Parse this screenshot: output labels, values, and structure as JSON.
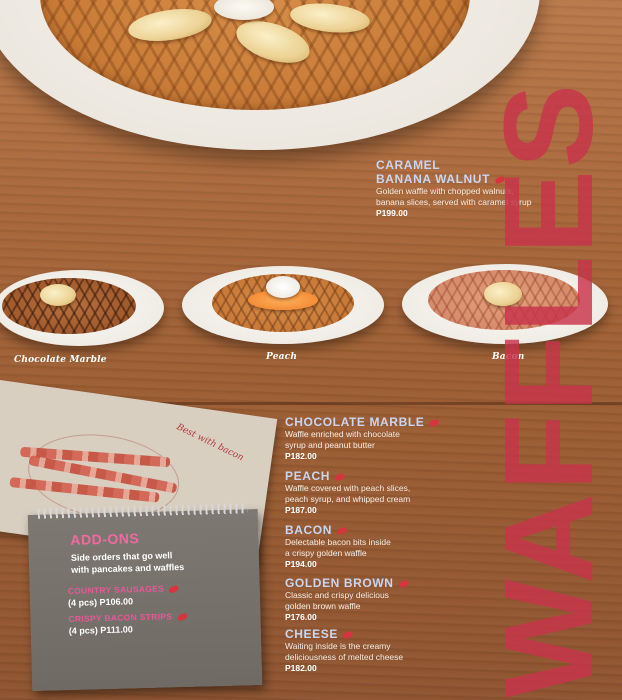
{
  "captions": {
    "chocolate_marble": "Chocolate Marble",
    "peach": "Peach",
    "bacon": "Bacon"
  },
  "featured": {
    "name_line1": "CARAMEL",
    "name_line2": "BANANA WALNUT",
    "desc_line1": "Golden waffle with chopped walnuts,",
    "desc_line2": "banana slices, served with caramel syrup",
    "price": "P199.00"
  },
  "items": [
    {
      "name": "CHOCOLATE MARBLE",
      "desc_line1": "Waffle enriched with chocolate",
      "desc_line2": "syrup and peanut butter",
      "price": "P182.00"
    },
    {
      "name": "PEACH",
      "desc_line1": "Waffle covered with peach slices,",
      "desc_line2": "peach syrup, and whipped cream",
      "price": "P187.00"
    },
    {
      "name": "BACON",
      "desc_line1": "Delectable bacon bits inside",
      "desc_line2": "a crispy golden waffle",
      "price": "P194.00"
    },
    {
      "name": "GOLDEN BROWN",
      "desc_line1": "Classic and crispy delicious",
      "desc_line2": "golden brown waffle",
      "price": "P176.00"
    },
    {
      "name": "CHEESE",
      "desc_line1": "Waiting inside is the creamy",
      "desc_line2": "deliciousness of melted cheese",
      "price": "P182.00"
    }
  ],
  "addons": {
    "title": "ADD-ONS",
    "subtitle_line1": "Side orders that go well",
    "subtitle_line2": "with pancakes and waffles",
    "list": [
      {
        "name": "COUNTRY SAUSAGES",
        "price": "(4 pcs) P106.00"
      },
      {
        "name": "CRISPY BACON STRIPS",
        "price": "(4 pcs) P111.00"
      }
    ]
  },
  "bacon_note": "Best with bacon",
  "section_word": "WAFFLES",
  "colors": {
    "accent": "#c8344b",
    "item_name": "#c9d6f2",
    "addon_name": "#e8589a"
  }
}
